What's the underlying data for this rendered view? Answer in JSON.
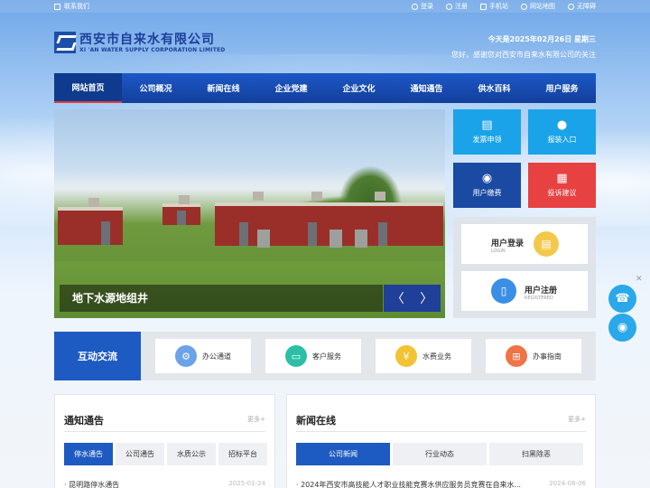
{
  "topbar": {
    "contact": "联系我们",
    "links": [
      "登录",
      "注册",
      "手机站",
      "网站地图",
      "无障碍"
    ]
  },
  "logo": {
    "cn": "西安市自来水有限公司",
    "en": "XI 'AN WATER SUPPLY CORPORATION LIMITED"
  },
  "header": {
    "date": "今天是2025年02月26日 星期三",
    "welcome": "您好，感谢您对西安市自来水有限公司的关注"
  },
  "nav": [
    "网站首页",
    "公司概况",
    "新闻在线",
    "企业党建",
    "企业文化",
    "通知通告",
    "供水百科",
    "用户服务"
  ],
  "banner": {
    "caption": "地下水源地组井",
    "prev": "〈",
    "next": "〉"
  },
  "quick_tiles": [
    {
      "label": "发票申领",
      "icon": "ticket-icon",
      "glyph": "▤",
      "color": "#1aa3e8"
    },
    {
      "label": "报装入口",
      "icon": "water-drop-icon",
      "glyph": "💧",
      "color": "#1aa3e8"
    },
    {
      "label": "用户缴费",
      "icon": "hand-coin-icon",
      "glyph": "✋",
      "color": "#1b4aa3"
    },
    {
      "label": "投诉建议",
      "icon": "document-icon",
      "glyph": "▦",
      "color": "#e84141"
    }
  ],
  "login_cards": [
    {
      "title": "用户登录",
      "sub": "LOGIN",
      "icon": "login-icon",
      "glyph": "▤",
      "color": "#f2c94c"
    },
    {
      "title": "用户注册",
      "sub": "REGISTERED",
      "icon": "register-icon",
      "glyph": "▯",
      "color": "#3a8ee6"
    }
  ],
  "interact": {
    "title": "互动交流",
    "items": [
      {
        "label": "办公通道",
        "icon": "settings-icon",
        "glyph": "⚙",
        "color": "#6aa3e8"
      },
      {
        "label": "客户服务",
        "icon": "monitor-icon",
        "glyph": "▭",
        "color": "#2dbfa6"
      },
      {
        "label": "水费业务",
        "icon": "yen-icon",
        "glyph": "¥",
        "color": "#f2c332"
      },
      {
        "label": "办事指南",
        "icon": "grid-icon",
        "glyph": "⊞",
        "color": "#ef7446"
      }
    ]
  },
  "notice": {
    "title": "通知通告",
    "more": "更多+",
    "tabs": [
      "停水通告",
      "公司通告",
      "水质公示",
      "招标平台"
    ],
    "item": "昆明路停水通告",
    "date": "2025-01-24"
  },
  "news": {
    "title": "新闻在线",
    "more": "更多+",
    "tabs": [
      "公司新闻",
      "行业动态",
      "扫黑除恶"
    ],
    "item": "2024年西安市高技能人才职业技能竞赛水供应服务员竞赛在自来水...",
    "date": "2024-08-06"
  },
  "float": {
    "phone_icon": "phone-icon",
    "wechat_icon": "wechat-icon",
    "close": "✕"
  }
}
